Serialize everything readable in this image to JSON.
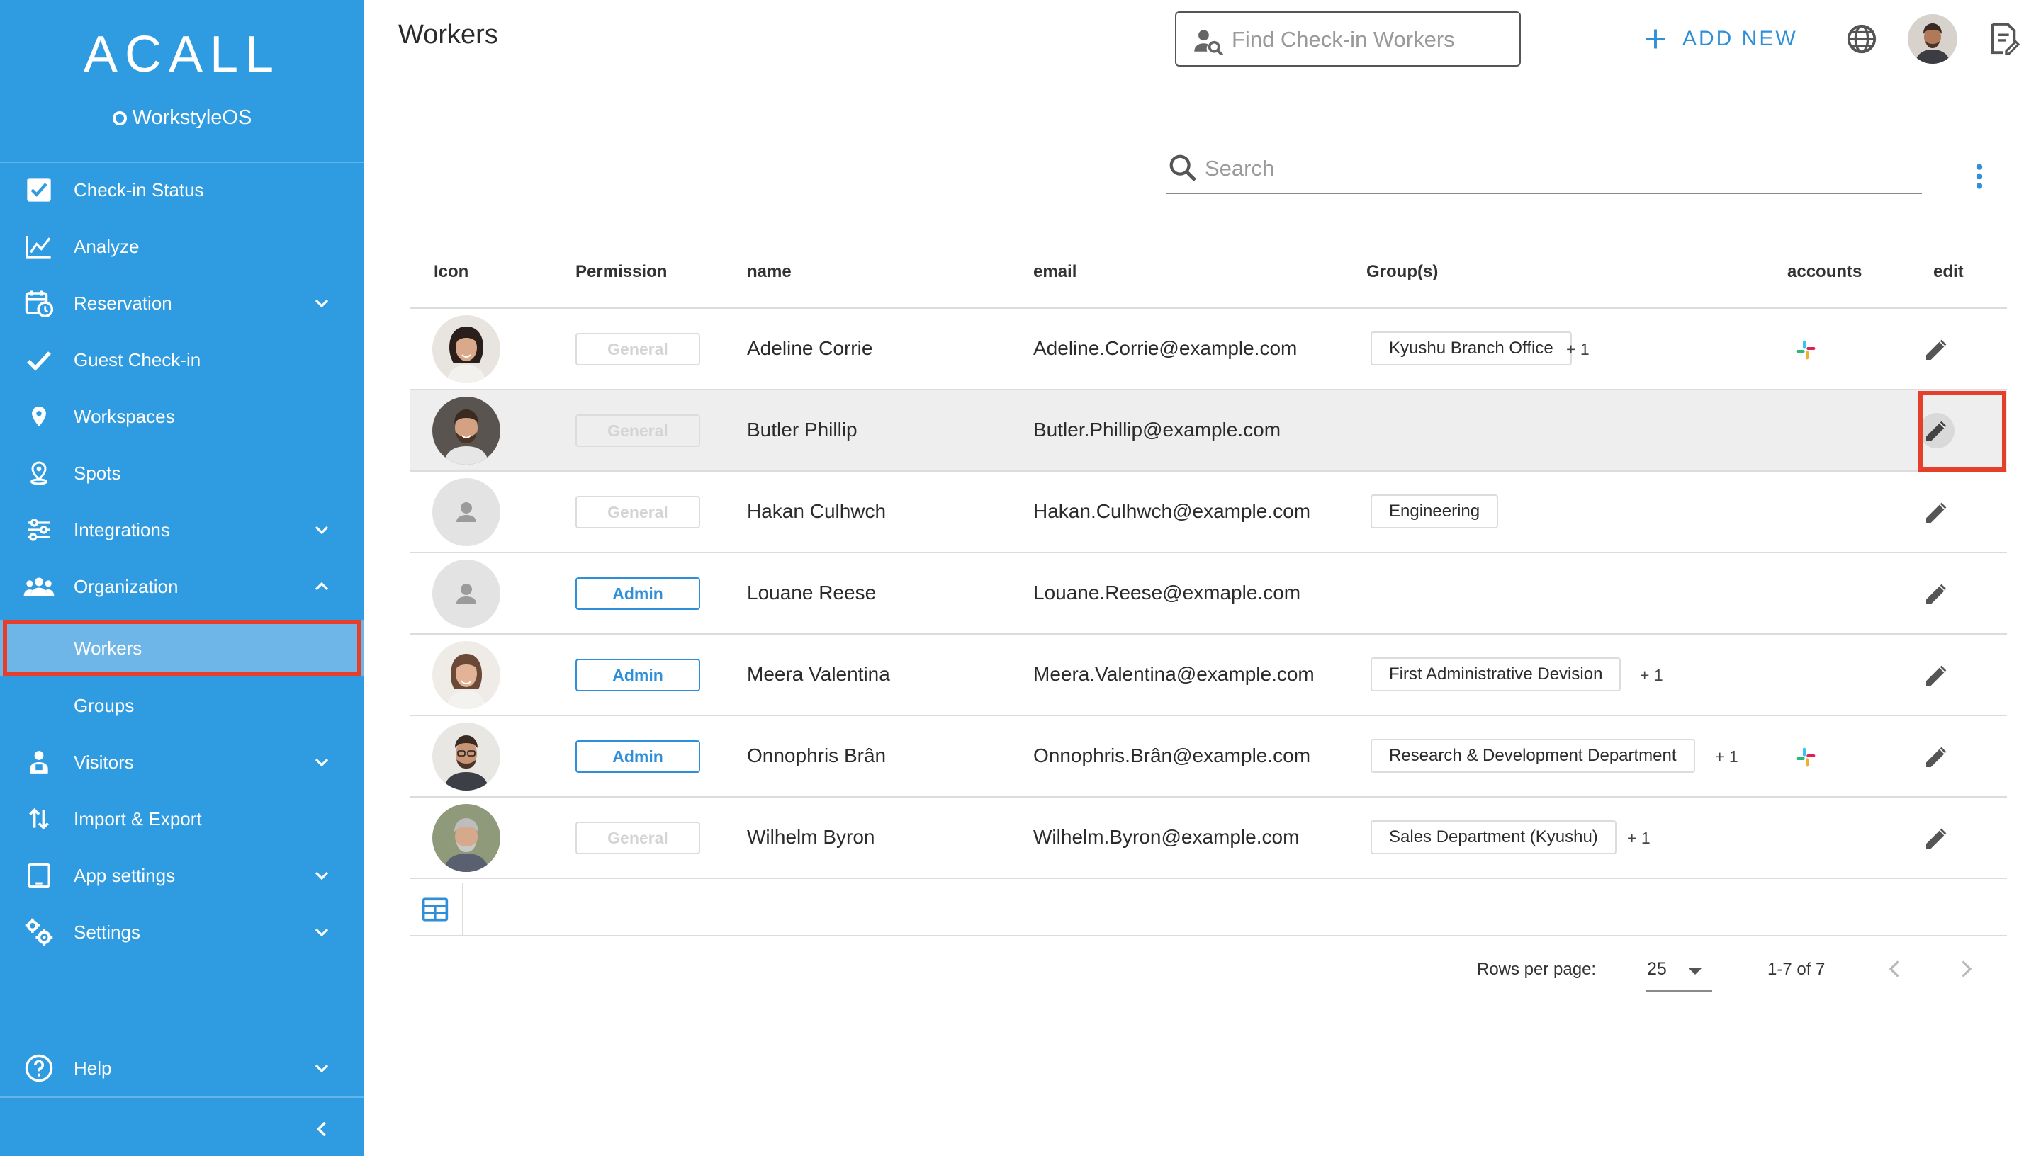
{
  "brand": {
    "logo": "ACALL",
    "product": "WorkstyleOS"
  },
  "sidebar": {
    "items": [
      {
        "label": "Check-in Status",
        "icon": "checkbox-icon"
      },
      {
        "label": "Analyze",
        "icon": "chart-line-icon"
      },
      {
        "label": "Reservation",
        "icon": "calendar-clock-icon",
        "expandable": true,
        "expanded": false
      },
      {
        "label": "Guest Check-in",
        "icon": "check-icon"
      },
      {
        "label": "Workspaces",
        "icon": "location-pin-icon"
      },
      {
        "label": "Spots",
        "icon": "pin-marker-icon"
      },
      {
        "label": "Integrations",
        "icon": "sliders-icon",
        "expandable": true,
        "expanded": false
      },
      {
        "label": "Organization",
        "icon": "people-group-icon",
        "expandable": true,
        "expanded": true
      },
      {
        "label": "Workers",
        "sub": true,
        "active": true
      },
      {
        "label": "Groups",
        "sub": true
      },
      {
        "label": "Visitors",
        "icon": "visitor-icon",
        "expandable": true,
        "expanded": false
      },
      {
        "label": "Import & Export",
        "icon": "import-export-icon"
      },
      {
        "label": "App settings",
        "icon": "tablet-icon",
        "expandable": true,
        "expanded": false
      },
      {
        "label": "Settings",
        "icon": "gears-icon",
        "expandable": true,
        "expanded": false
      }
    ],
    "help": {
      "label": "Help",
      "icon": "help-circle-icon"
    }
  },
  "header": {
    "title": "Workers",
    "find_placeholder": "Find Check-in Workers",
    "add_new_label": "ADD NEW"
  },
  "search": {
    "placeholder": "Search"
  },
  "table": {
    "columns": [
      "Icon",
      "Permission",
      "name",
      "email",
      "Group(s)",
      "accounts",
      "edit"
    ],
    "rows": [
      {
        "permission": "General",
        "name": "Adeline Corrie",
        "email": "Adeline.Corrie@example.com",
        "group": "Kyushu Branch Office",
        "extra": "+ 1",
        "slack": true,
        "avatar": "photo-woman-1"
      },
      {
        "permission": "General",
        "name": "Butler Phillip",
        "email": "Butler.Phillip@example.com",
        "group": "",
        "extra": "",
        "slack": false,
        "avatar": "photo-man-1",
        "selected": true
      },
      {
        "permission": "General",
        "name": "Hakan Culhwch",
        "email": "Hakan.Culhwch@example.com",
        "group": "Engineering",
        "extra": "",
        "slack": false,
        "avatar": "default-person"
      },
      {
        "permission": "Admin",
        "name": "Louane Reese",
        "email": "Louane.Reese@exmaple.com",
        "group": "",
        "extra": "",
        "slack": false,
        "avatar": "default-person"
      },
      {
        "permission": "Admin",
        "name": "Meera Valentina",
        "email": "Meera.Valentina@example.com",
        "group": "First Administrative Devision",
        "extra": "+ 1",
        "slack": false,
        "avatar": "photo-woman-2"
      },
      {
        "permission": "Admin",
        "name": "Onnophris Brân",
        "email": "Onnophris.Brân@example.com",
        "group": "Research & Development Department",
        "extra": "+ 1",
        "slack": true,
        "avatar": "photo-man-2"
      },
      {
        "permission": "General",
        "name": "Wilhelm Byron",
        "email": "Wilhelm.Byron@example.com",
        "group": "Sales Department (Kyushu)",
        "extra": "+ 1",
        "slack": false,
        "avatar": "photo-man-3"
      }
    ]
  },
  "pagination": {
    "rows_label": "Rows per page:",
    "rows_value": "25",
    "range": "1-7 of 7"
  },
  "colors": {
    "sidebar": "#2f9be0",
    "accent": "#2f8fd8",
    "highlight": "#e53e2a"
  }
}
